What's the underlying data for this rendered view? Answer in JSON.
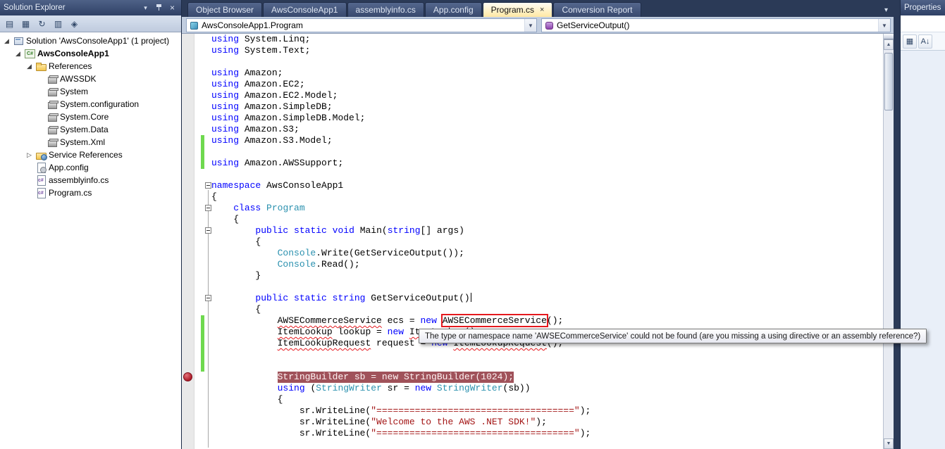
{
  "colors": {
    "keyword": "#0000FF",
    "type": "#2B91AF",
    "string": "#A31515",
    "error": "#E5191E",
    "breakpoint_line_bg": "#A0525A",
    "breakpoint_line_fg": "#FFF4F4",
    "change_bar": "#6FD94F",
    "active_tab": "#FFE8A4",
    "chrome": "#2B3A57"
  },
  "glyphs": {
    "combo_arrow": "▼",
    "window_menu": "▾",
    "close": "×",
    "tab_close": "×",
    "tab_overflow": "▾",
    "scroll_up": "▲",
    "scroll_down": "▼",
    "expanded": "◢",
    "collapsed": "▷",
    "none": ""
  },
  "solution_explorer": {
    "title": "Solution Explorer",
    "toolbar_icons": [
      {
        "name": "properties-icon",
        "glyph": "▤"
      },
      {
        "name": "show-all-files-icon",
        "glyph": "▦"
      },
      {
        "name": "refresh-icon",
        "glyph": "↻"
      },
      {
        "name": "view-class-diagram-icon",
        "glyph": "▥"
      },
      {
        "name": "code-metrics-icon",
        "glyph": "◈"
      }
    ],
    "tree": [
      {
        "indent": 0,
        "expander": "expanded",
        "icon": "solution",
        "label": "Solution 'AwsConsoleApp1' (1 project)",
        "bold": false
      },
      {
        "indent": 1,
        "expander": "expanded",
        "icon": "project",
        "label": "AwsConsoleApp1",
        "bold": true
      },
      {
        "indent": 2,
        "expander": "expanded",
        "icon": "folder",
        "label": "References",
        "bold": false
      },
      {
        "indent": 3,
        "expander": "none",
        "icon": "reference",
        "label": "AWSSDK",
        "bold": false
      },
      {
        "indent": 3,
        "expander": "none",
        "icon": "reference",
        "label": "System",
        "bold": false
      },
      {
        "indent": 3,
        "expander": "none",
        "icon": "reference",
        "label": "System.configuration",
        "bold": false
      },
      {
        "indent": 3,
        "expander": "none",
        "icon": "reference",
        "label": "System.Core",
        "bold": false
      },
      {
        "indent": 3,
        "expander": "none",
        "icon": "reference",
        "label": "System.Data",
        "bold": false
      },
      {
        "indent": 3,
        "expander": "none",
        "icon": "reference",
        "label": "System.Xml",
        "bold": false
      },
      {
        "indent": 2,
        "expander": "collapsed",
        "icon": "service",
        "label": "Service References",
        "bold": false
      },
      {
        "indent": 2,
        "expander": "none",
        "icon": "config",
        "label": "App.config",
        "bold": false
      },
      {
        "indent": 2,
        "expander": "none",
        "icon": "csfile",
        "label": "assemblyinfo.cs",
        "bold": false
      },
      {
        "indent": 2,
        "expander": "none",
        "icon": "csfile",
        "label": "Program.cs",
        "bold": false
      }
    ]
  },
  "tabs": [
    {
      "label": "Object Browser",
      "active": false
    },
    {
      "label": "AwsConsoleApp1",
      "active": false
    },
    {
      "label": "assemblyinfo.cs",
      "active": false
    },
    {
      "label": "App.config",
      "active": false
    },
    {
      "label": "Program.cs",
      "active": true
    },
    {
      "label": "Conversion Report",
      "active": false
    }
  ],
  "navbar": {
    "left_combo": "AwsConsoleApp1.Program",
    "right_combo": "GetServiceOutput()"
  },
  "properties_panel": {
    "title": "Properties",
    "toolbar_icons": [
      {
        "name": "categorized-icon",
        "glyph": "▦"
      },
      {
        "name": "alphabetical-sort-icon",
        "glyph": "A↓"
      }
    ]
  },
  "editor": {
    "tooltip": "The type or namespace name 'AWSECommerceService' could not be found (are you missing a using directive or an assembly reference?)",
    "breakpoint_row": 30,
    "outline_rows": [
      13,
      15,
      17,
      23
    ],
    "change_bars": [
      {
        "from": 9,
        "to": 11
      },
      {
        "from": 25,
        "to": 29
      }
    ],
    "lines": [
      [
        [
          "kw",
          "using"
        ],
        [
          "pl",
          " System.Linq;"
        ]
      ],
      [
        [
          "kw",
          "using"
        ],
        [
          "pl",
          " System.Text;"
        ]
      ],
      [],
      [
        [
          "kw",
          "using"
        ],
        [
          "pl",
          " Amazon;"
        ]
      ],
      [
        [
          "kw",
          "using"
        ],
        [
          "pl",
          " Amazon.EC2;"
        ]
      ],
      [
        [
          "kw",
          "using"
        ],
        [
          "pl",
          " Amazon.EC2.Model;"
        ]
      ],
      [
        [
          "kw",
          "using"
        ],
        [
          "pl",
          " Amazon.SimpleDB;"
        ]
      ],
      [
        [
          "kw",
          "using"
        ],
        [
          "pl",
          " Amazon.SimpleDB.Model;"
        ]
      ],
      [
        [
          "kw",
          "using"
        ],
        [
          "pl",
          " Amazon.S3;"
        ]
      ],
      [
        [
          "kw",
          "using"
        ],
        [
          "pl",
          " Amazon.S3.Model;"
        ]
      ],
      [],
      [
        [
          "kw",
          "using"
        ],
        [
          "pl",
          " Amazon.AWSSupport;"
        ]
      ],
      [],
      [
        [
          "kw",
          "namespace"
        ],
        [
          "pl",
          " AwsConsoleApp1"
        ]
      ],
      [
        [
          "pl",
          "{"
        ]
      ],
      [
        [
          "pl",
          "    "
        ],
        [
          "kw",
          "class"
        ],
        [
          "pl",
          " "
        ],
        [
          "type",
          "Program"
        ]
      ],
      [
        [
          "pl",
          "    {"
        ]
      ],
      [
        [
          "pl",
          "        "
        ],
        [
          "kw",
          "public"
        ],
        [
          "pl",
          " "
        ],
        [
          "kw",
          "static"
        ],
        [
          "pl",
          " "
        ],
        [
          "kw",
          "void"
        ],
        [
          "pl",
          " Main("
        ],
        [
          "kw",
          "string"
        ],
        [
          "pl",
          "[] args)"
        ]
      ],
      [
        [
          "pl",
          "        {"
        ]
      ],
      [
        [
          "pl",
          "            "
        ],
        [
          "type",
          "Console"
        ],
        [
          "pl",
          ".Write(GetServiceOutput());"
        ]
      ],
      [
        [
          "pl",
          "            "
        ],
        [
          "type",
          "Console"
        ],
        [
          "pl",
          ".Read();"
        ]
      ],
      [
        [
          "pl",
          "        }"
        ]
      ],
      [],
      [
        [
          "pl",
          "        "
        ],
        [
          "kw",
          "public"
        ],
        [
          "pl",
          " "
        ],
        [
          "kw",
          "static"
        ],
        [
          "pl",
          " "
        ],
        [
          "kw",
          "string"
        ],
        [
          "pl",
          " GetServiceOutput()"
        ],
        [
          "caret",
          ""
        ]
      ],
      [
        [
          "pl",
          "        {"
        ]
      ],
      [
        [
          "pl",
          "            "
        ],
        [
          "sq",
          "AWSECommerceService"
        ],
        [
          "pl",
          " ecs = "
        ],
        [
          "kw",
          "new"
        ],
        [
          "pl",
          " "
        ],
        [
          "box",
          "AWSECommerceService"
        ],
        [
          "pl",
          "();"
        ]
      ],
      [
        [
          "pl",
          "            "
        ],
        [
          "sq",
          "ItemLookup"
        ],
        [
          "pl",
          " lookup = "
        ],
        [
          "kw",
          "new"
        ],
        [
          "pl",
          " "
        ],
        [
          "sq",
          "ItemLookup"
        ],
        [
          "pl",
          "();"
        ]
      ],
      [
        [
          "pl",
          "            "
        ],
        [
          "sq",
          "ItemLookupRequest"
        ],
        [
          "pl",
          " request = "
        ],
        [
          "kw",
          "new"
        ],
        [
          "pl",
          " "
        ],
        [
          "sq",
          "ItemLookupRequest"
        ],
        [
          "pl",
          "();"
        ]
      ],
      [],
      [],
      [
        [
          "pl",
          "            "
        ],
        [
          "bp",
          "StringBuilder sb = new StringBuilder(1024);"
        ]
      ],
      [
        [
          "pl",
          "            "
        ],
        [
          "kw",
          "using"
        ],
        [
          "pl",
          " ("
        ],
        [
          "type",
          "StringWriter"
        ],
        [
          "pl",
          " sr = "
        ],
        [
          "kw",
          "new"
        ],
        [
          "pl",
          " "
        ],
        [
          "type",
          "StringWriter"
        ],
        [
          "pl",
          "(sb))"
        ]
      ],
      [
        [
          "pl",
          "            {"
        ]
      ],
      [
        [
          "pl",
          "                sr.WriteLine("
        ],
        [
          "str",
          "\"====================================\""
        ],
        [
          "pl",
          ");"
        ]
      ],
      [
        [
          "pl",
          "                sr.WriteLine("
        ],
        [
          "str",
          "\"Welcome to the AWS .NET SDK!\""
        ],
        [
          "pl",
          ");"
        ]
      ],
      [
        [
          "pl",
          "                sr.WriteLine("
        ],
        [
          "str",
          "\"====================================\""
        ],
        [
          "pl",
          ");"
        ]
      ],
      []
    ]
  }
}
